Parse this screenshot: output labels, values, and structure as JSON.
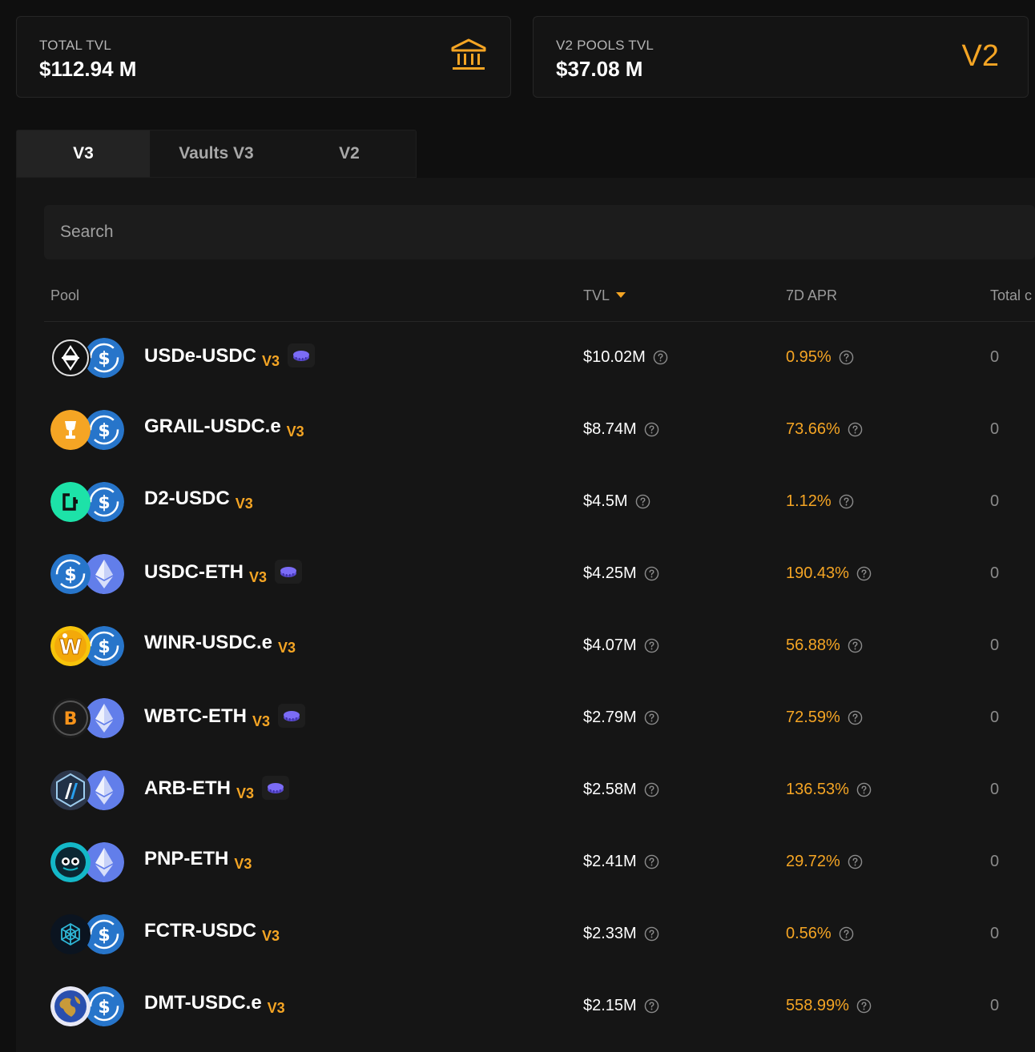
{
  "stats": {
    "total_tvl_label": "TOTAL TVL",
    "total_tvl_value": "$112.94 M",
    "v2_tvl_label": "V2 POOLS TVL",
    "v2_tvl_value": "$37.08 M",
    "v2_badge": "V2"
  },
  "tabs": [
    {
      "label": "V3",
      "active": true
    },
    {
      "label": "Vaults V3",
      "active": false
    },
    {
      "label": "V2",
      "active": false
    }
  ],
  "search": {
    "placeholder": "Search",
    "value": ""
  },
  "table": {
    "headers": {
      "pool": "Pool",
      "tvl": "TVL",
      "apr": "7D APR",
      "total": "Total c"
    },
    "sort": {
      "column": "tvl",
      "direction": "desc"
    },
    "rows": [
      {
        "pool": "USDe-USDC",
        "version": "V3",
        "tokens": [
          "usde-icon",
          "usdc-icon"
        ],
        "coin_badge": true,
        "tvl": "$10.02M",
        "apr": "0.95%",
        "total": "0"
      },
      {
        "pool": "GRAIL-USDC.e",
        "version": "V3",
        "tokens": [
          "grail-icon",
          "usdc-icon"
        ],
        "coin_badge": false,
        "tvl": "$8.74M",
        "apr": "73.66%",
        "total": "0"
      },
      {
        "pool": "D2-USDC",
        "version": "V3",
        "tokens": [
          "d2-icon",
          "usdc-icon"
        ],
        "coin_badge": false,
        "tvl": "$4.5M",
        "apr": "1.12%",
        "total": "0"
      },
      {
        "pool": "USDC-ETH",
        "version": "V3",
        "tokens": [
          "usdc-icon",
          "eth-icon"
        ],
        "coin_badge": true,
        "tvl": "$4.25M",
        "apr": "190.43%",
        "total": "0"
      },
      {
        "pool": "WINR-USDC.e",
        "version": "V3",
        "tokens": [
          "winr-icon",
          "usdc-icon"
        ],
        "coin_badge": false,
        "tvl": "$4.07M",
        "apr": "56.88%",
        "total": "0"
      },
      {
        "pool": "WBTC-ETH",
        "version": "V3",
        "tokens": [
          "wbtc-icon",
          "eth-icon"
        ],
        "coin_badge": true,
        "tvl": "$2.79M",
        "apr": "72.59%",
        "total": "0"
      },
      {
        "pool": "ARB-ETH",
        "version": "V3",
        "tokens": [
          "arb-icon",
          "eth-icon"
        ],
        "coin_badge": true,
        "tvl": "$2.58M",
        "apr": "136.53%",
        "total": "0"
      },
      {
        "pool": "PNP-ETH",
        "version": "V3",
        "tokens": [
          "pnp-icon",
          "eth-icon"
        ],
        "coin_badge": false,
        "tvl": "$2.41M",
        "apr": "29.72%",
        "total": "0"
      },
      {
        "pool": "FCTR-USDC",
        "version": "V3",
        "tokens": [
          "fctr-icon",
          "usdc-icon"
        ],
        "coin_badge": false,
        "tvl": "$2.33M",
        "apr": "0.56%",
        "total": "0"
      },
      {
        "pool": "DMT-USDC.e",
        "version": "V3",
        "tokens": [
          "dmt-icon",
          "usdc-icon"
        ],
        "coin_badge": false,
        "tvl": "$2.15M",
        "apr": "558.99%",
        "total": "0"
      }
    ]
  },
  "colors": {
    "accent": "#f5a524",
    "background": "#0f0f0f",
    "panel": "#151515",
    "usdc": "#2775ca",
    "eth": "#627eea",
    "coin_badge": "#7b6cf6"
  }
}
